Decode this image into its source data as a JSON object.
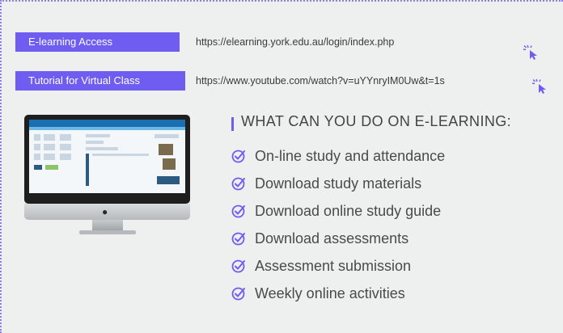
{
  "links": [
    {
      "label": "E-learning Access",
      "url": "https://elearning.york.edu.au/login/index.php"
    },
    {
      "label": "Tutorial for Virtual Class",
      "url": "https://www.youtube.com/watch?v=uYYnryIM0Uw&t=1s"
    }
  ],
  "section": {
    "title": "WHAT CAN YOU DO ON E-LEARNING:",
    "items": [
      "On-line study and attendance",
      "Download study materials",
      "Download online study guide",
      "Download assessments",
      "Assessment submission",
      "Weekly online activities"
    ]
  },
  "colors": {
    "accent": "#6f5cf0",
    "border": "#8a7ee8",
    "panel_bg": "#eef0ef"
  },
  "icons": {
    "cursor": "cursor-click-icon",
    "check": "check-circle-icon",
    "monitor": "desktop-computer-image"
  }
}
